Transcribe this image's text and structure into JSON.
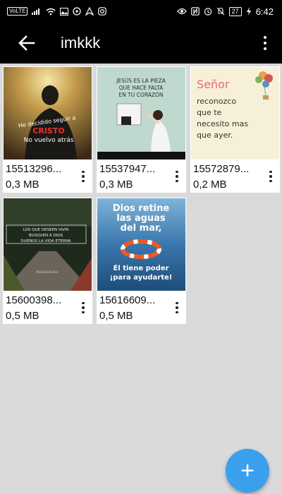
{
  "status_bar": {
    "volte": "VoLTE",
    "battery": "27",
    "time": "6:42",
    "icons": [
      "signal-icon",
      "wifi-icon",
      "image-icon",
      "whatsapp-icon",
      "navigation-icon",
      "instagram-icon",
      "eye-icon",
      "nfc-icon",
      "alarm-icon",
      "mute-icon",
      "battery-icon"
    ]
  },
  "app_bar": {
    "title": "imkkk",
    "back_icon": "arrow-left-icon",
    "menu_icon": "more-vert-icon"
  },
  "files": [
    {
      "name": "15513296...",
      "size": "0,3 MB",
      "thumb": {
        "lines": [
          "He decidido seguir a",
          "CRISTO",
          "No vuelvo atrás"
        ]
      }
    },
    {
      "name": "15537947...",
      "size": "0,3 MB",
      "thumb": {
        "lines": [
          "JESÚS ES LA PIEZA",
          "QUE HACE FALTA",
          "EN TU CORAZÓN"
        ]
      }
    },
    {
      "name": "15572879...",
      "size": "0,2 MB",
      "thumb": {
        "lines": [
          "Señor",
          "reconozco",
          "que te",
          "necesito mas",
          "que ayer."
        ]
      }
    },
    {
      "name": "15600398...",
      "size": "0,5 MB",
      "thumb": {
        "lines": [
          "LOS QUE DESEEN VIVIR",
          "BUSQUEN A DIOS",
          "DUEÑOS LA VIDA ETERNA",
          "#DiaDelSeñor"
        ]
      }
    },
    {
      "name": "15616609...",
      "size": "0,5 MB",
      "thumb": {
        "lines": [
          "Dios retine",
          "las aguas",
          "del mar,",
          "Él tiene poder",
          "¡para ayudarte!"
        ]
      }
    }
  ],
  "fab": {
    "label": "+",
    "icon": "plus-icon"
  }
}
